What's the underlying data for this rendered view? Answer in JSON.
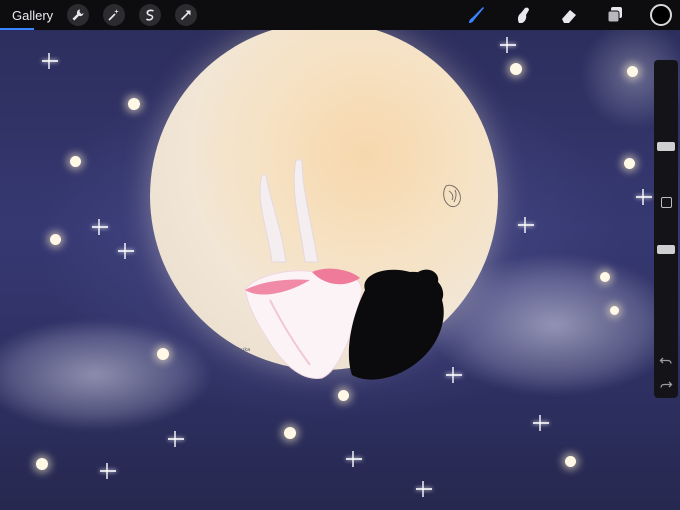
{
  "toolbar": {
    "gallery_label": "Gallery",
    "left_tools": [
      "wrench-icon",
      "magic-wand-icon",
      "selection-icon",
      "transform-arrow-icon"
    ],
    "right_tools": [
      "brush-icon",
      "smudge-icon",
      "eraser-icon",
      "layers-icon"
    ],
    "active_tool": "brush-icon",
    "accent_color": "#3a84ff",
    "current_color": "#000000"
  },
  "sidebar": {
    "brush_size": 0.3,
    "opacity": 0.78
  },
  "artwork": {
    "signature_text": "Ashuka"
  }
}
